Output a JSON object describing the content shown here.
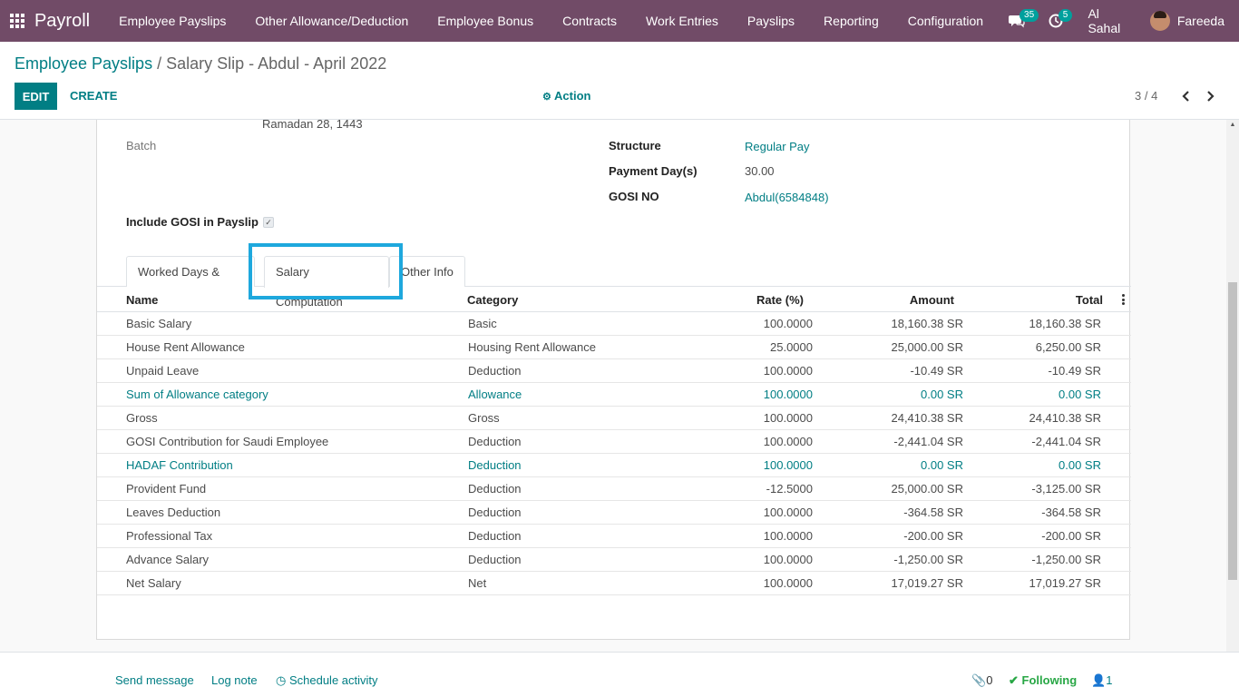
{
  "navbar": {
    "app_name": "Payroll",
    "menu": [
      "Employee Payslips",
      "Other Allowance/Deduction",
      "Employee Bonus",
      "Contracts",
      "Work Entries",
      "Payslips",
      "Reporting",
      "Configuration"
    ],
    "messages_count": "35",
    "activities_count": "5",
    "company": "Al Sahal",
    "user": "Fareeda",
    "bg_color": "#714b67"
  },
  "control_panel": {
    "breadcrumb_parent": "Employee Payslips",
    "breadcrumb_separator": " / ",
    "breadcrumb_current": "Salary Slip - Abdul - April 2022",
    "edit_label": "EDIT",
    "create_label": "CREATE",
    "action_label": "Action",
    "pager": "3 / 4"
  },
  "form": {
    "date_value": "Ramadan 28, 1443",
    "batch_label": "Batch",
    "structure_label": "Structure",
    "structure_value": "Regular Pay",
    "payment_days_label": "Payment Day(s)",
    "payment_days_value": "30.00",
    "gosi_label": "GOSI NO",
    "gosi_value": "Abdul(6584848)",
    "include_gosi_label": "Include GOSI in Payslip",
    "include_gosi_checked": true
  },
  "tabs": [
    "Worked Days & Inputs",
    "Salary Computation",
    "Other Info"
  ],
  "active_tab": "Salary Computation",
  "table": {
    "columns": [
      "Name",
      "Category",
      "Rate (%)",
      "Amount",
      "Total"
    ],
    "rows": [
      {
        "name": "Basic Salary",
        "category": "Basic",
        "rate": "100.0000",
        "amount": "18,160.38 SR",
        "total": "18,160.38 SR",
        "link": false
      },
      {
        "name": "House Rent Allowance",
        "category": "Housing Rent Allowance",
        "rate": "25.0000",
        "amount": "25,000.00 SR",
        "total": "6,250.00 SR",
        "link": false
      },
      {
        "name": "Unpaid Leave",
        "category": "Deduction",
        "rate": "100.0000",
        "amount": "-10.49 SR",
        "total": "-10.49 SR",
        "link": false
      },
      {
        "name": "Sum of Allowance category",
        "category": "Allowance",
        "rate": "100.0000",
        "amount": "0.00 SR",
        "total": "0.00 SR",
        "link": true
      },
      {
        "name": "Gross",
        "category": "Gross",
        "rate": "100.0000",
        "amount": "24,410.38 SR",
        "total": "24,410.38 SR",
        "link": false
      },
      {
        "name": "GOSI Contribution for Saudi Employee",
        "category": "Deduction",
        "rate": "100.0000",
        "amount": "-2,441.04 SR",
        "total": "-2,441.04 SR",
        "link": false
      },
      {
        "name": "HADAF Contribution",
        "category": "Deduction",
        "rate": "100.0000",
        "amount": "0.00 SR",
        "total": "0.00 SR",
        "link": true
      },
      {
        "name": "Provident Fund",
        "category": "Deduction",
        "rate": "-12.5000",
        "amount": "25,000.00 SR",
        "total": "-3,125.00 SR",
        "link": false
      },
      {
        "name": "Leaves Deduction",
        "category": "Deduction",
        "rate": "100.0000",
        "amount": "-364.58 SR",
        "total": "-364.58 SR",
        "link": false
      },
      {
        "name": "Professional Tax",
        "category": "Deduction",
        "rate": "100.0000",
        "amount": "-200.00 SR",
        "total": "-200.00 SR",
        "link": false
      },
      {
        "name": "Advance Salary",
        "category": "Deduction",
        "rate": "100.0000",
        "amount": "-1,250.00 SR",
        "total": "-1,250.00 SR",
        "link": false
      },
      {
        "name": "Net Salary",
        "category": "Net",
        "rate": "100.0000",
        "amount": "17,019.27 SR",
        "total": "17,019.27 SR",
        "link": false
      }
    ]
  },
  "chatter": {
    "send_message": "Send message",
    "log_note": "Log note",
    "schedule_activity": "Schedule activity",
    "attachments_count": "0",
    "following": "Following",
    "followers_count": "1"
  }
}
